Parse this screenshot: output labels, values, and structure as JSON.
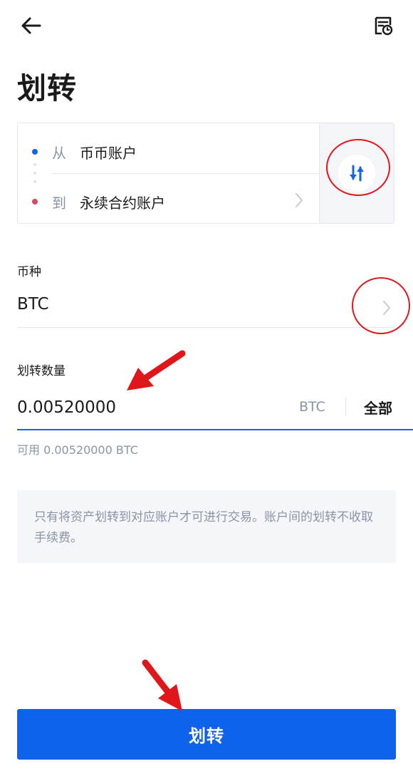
{
  "header": {
    "back_icon": "arrow-left-icon",
    "history_icon": "transfer-history-icon",
    "title": "划转"
  },
  "accounts": {
    "from_prefix": "从",
    "from_account": "币币账户",
    "to_prefix": "到",
    "to_account": "永续合约账户",
    "swap_icon": "swap-vertical-icon",
    "colors": {
      "from_dot": "#1264e8",
      "to_dot": "#d44a5c"
    }
  },
  "currency": {
    "label": "币种",
    "value": "BTC"
  },
  "amount": {
    "label": "划转数量",
    "value": "0.00520000",
    "unit": "BTC",
    "all_label": "全部",
    "available_text": "可用 0.00520000 BTC"
  },
  "notice": {
    "text": "只有将资产划转到对应账户才可进行交易。账户间的划转不收取手续费。"
  },
  "submit": {
    "label": "划转",
    "color": "#0f63ea"
  },
  "annotations": {
    "color": "#e1161a"
  }
}
